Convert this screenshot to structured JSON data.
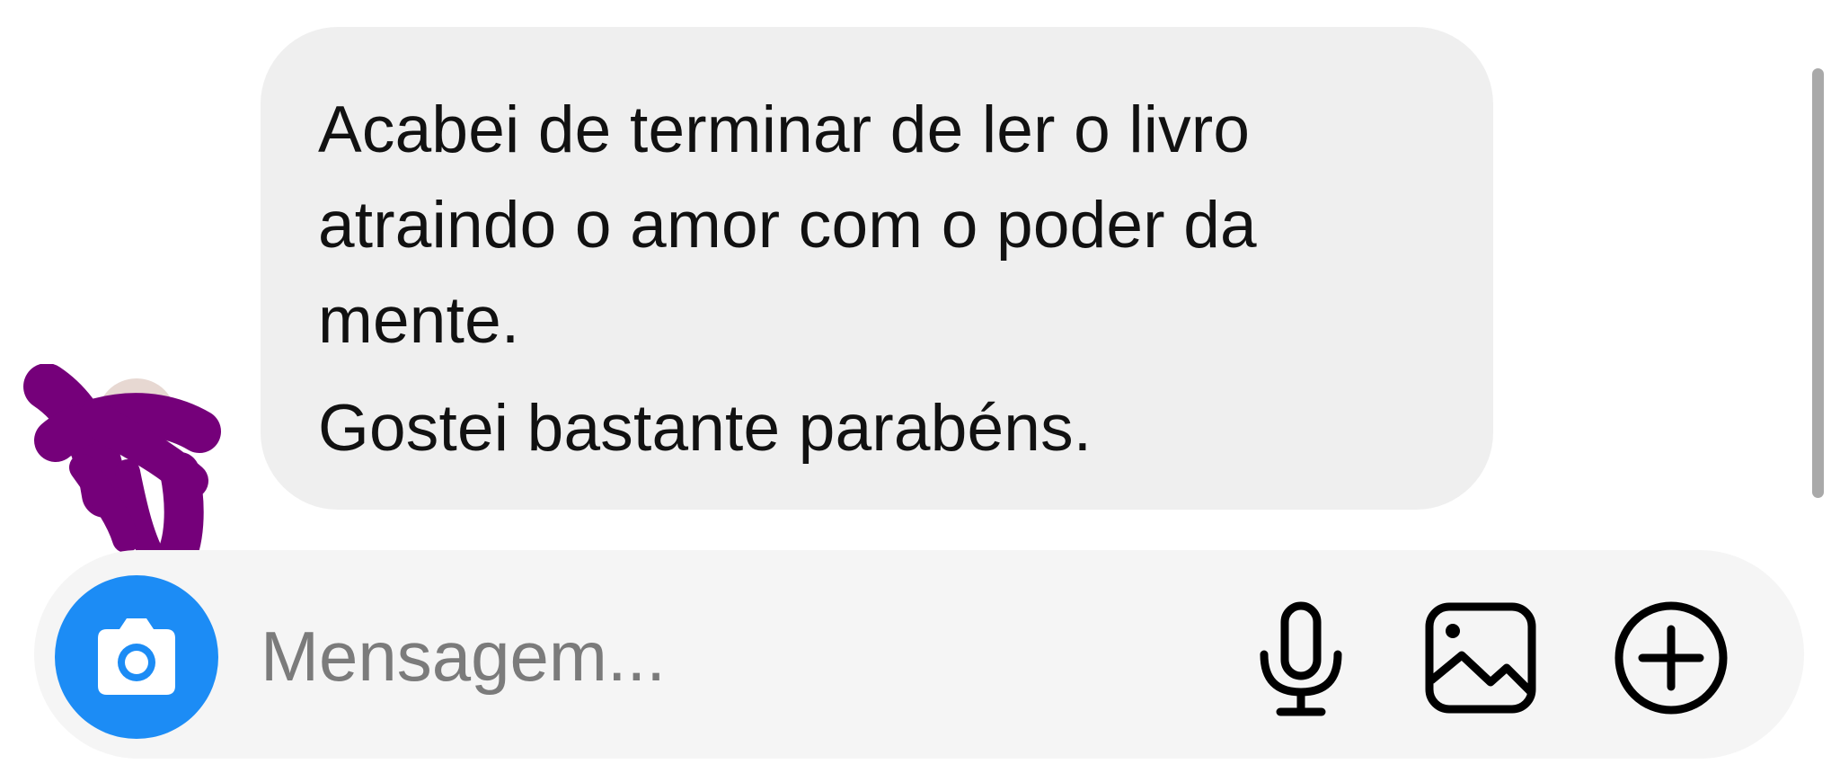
{
  "conversation": {
    "message": {
      "lines": [
        "Acabei de terminar de ler o livro",
        "atraindo o amor com o poder da",
        "mente.",
        "Gostei bastante parabéns."
      ]
    },
    "avatar": {
      "icon": "redacted-avatar-scribble",
      "scribble_color": "#75007a"
    }
  },
  "composer": {
    "placeholder": "Mensagem...",
    "camera_button": {
      "icon": "camera-icon",
      "color": "#1c8cf5"
    },
    "actions": [
      {
        "icon": "microphone-icon"
      },
      {
        "icon": "image-gallery-icon"
      },
      {
        "icon": "plus-circle-icon"
      }
    ]
  },
  "colors": {
    "bubble": "#efefef",
    "composer": "#f5f5f5",
    "text": "#111111",
    "placeholder": "#7b7b7b",
    "scrollbar": "#a9a9a9"
  }
}
